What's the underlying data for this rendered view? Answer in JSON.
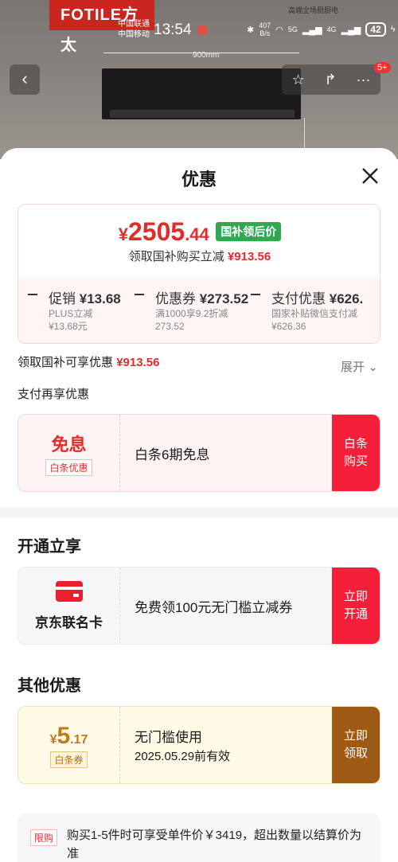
{
  "background": {
    "brand": "FOTILE方太",
    "measure": "900mm",
    "promo": "高端全场厨厨电"
  },
  "status_bar": {
    "carrier1": "中国联通",
    "carrier2": "中国移动",
    "time": "13:54",
    "speed": "407",
    "speed_unit": "B/s",
    "net1": "5G",
    "net2": "4G",
    "battery": "42"
  },
  "nav": {
    "back_icon": "chevron-left-icon",
    "badge": "5+"
  },
  "sheet": {
    "title": "优惠",
    "price": {
      "yen": "¥",
      "integer": "2505",
      "decimal": ".44",
      "tag": "国补领后价",
      "sub_label": "领取国补购买立减",
      "sub_amount": "¥913.56"
    },
    "breakdown": [
      {
        "label": "促销",
        "amount": "¥13.68",
        "line1": "PLUS立减",
        "line2": "¥13.68元"
      },
      {
        "label": "优惠券",
        "amount": "¥273.52",
        "line1": "满1000享9.2折减",
        "line2": "273.52"
      },
      {
        "label": "支付优惠",
        "amount": "¥626.",
        "line1": "国家补贴微信支付减",
        "line2": "¥626.36"
      }
    ],
    "gov": {
      "label": "领取国补可享优惠",
      "amount": "¥913.56"
    },
    "expand": "展开",
    "pay_title": "支付再享优惠",
    "coupon1": {
      "big": "免息",
      "tag": "白条优惠",
      "desc": "白条6期免息",
      "btn1": "白条",
      "btn2": "购买"
    },
    "section2": "开通立享",
    "coupon2": {
      "name": "京东联名卡",
      "desc": "免费领100元无门槛立减券",
      "btn1": "立即",
      "btn2": "开通"
    },
    "section3": "其他优惠",
    "coupon3": {
      "yen": "¥",
      "int": "5",
      "dec": ".17",
      "tag": "白条券",
      "title": "无门槛使用",
      "date": "2025.05.29前有效",
      "btn1": "立即",
      "btn2": "领取"
    },
    "limit": {
      "tag": "限购",
      "text": "购买1-5件时可享受单件价￥3419，超出数量以结算价为准"
    }
  }
}
